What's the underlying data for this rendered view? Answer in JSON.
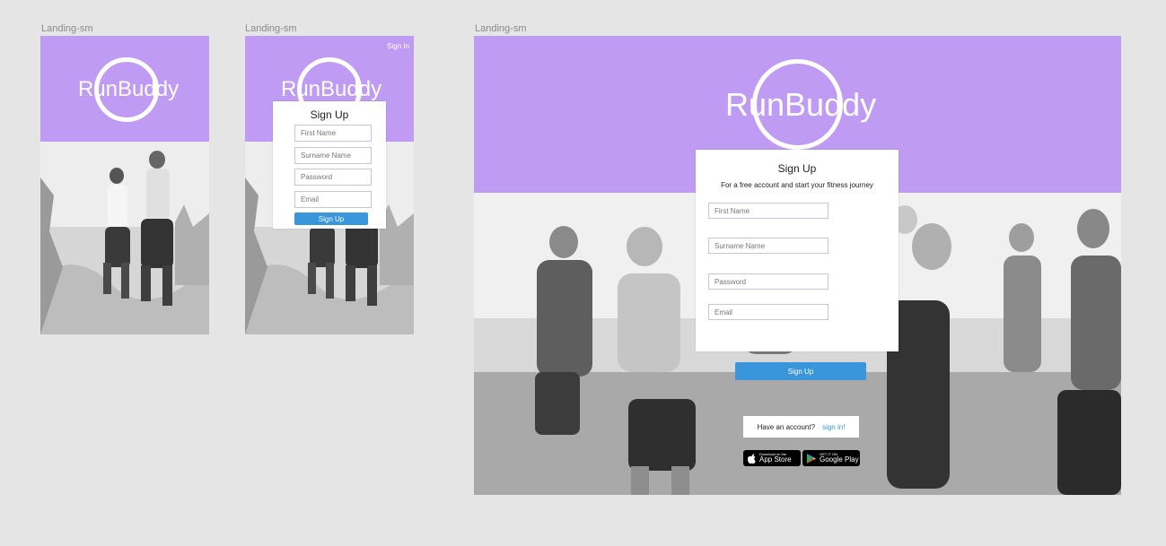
{
  "brand": "RunBuddy",
  "colors": {
    "header": "#bf9bf3",
    "button": "#3a96da",
    "canvas": "#e5e5e5",
    "link": "#3a96da"
  },
  "frames": [
    {
      "label": "Landing-sm"
    },
    {
      "label": "Landing-sm",
      "signin_link": "Sign In",
      "signup": {
        "title": "Sign Up",
        "fields": [
          "First Name",
          "Surname Name",
          "Password",
          "Email"
        ],
        "button": "Sign Up"
      }
    },
    {
      "label": "Landing-sm",
      "signup": {
        "title": "Sign Up",
        "subtitle": "For a free account and start your fitness journey",
        "fields": [
          "First Name",
          "Surname Name",
          "Password",
          "Email"
        ],
        "button": "Sign Up"
      },
      "have_account": "Have an account?",
      "signin_link": "sign in!",
      "app_store": {
        "small": "Download on the",
        "big": "App Store",
        "icon": "apple-icon"
      },
      "google_play": {
        "small": "GET IT ON",
        "big": "Google Play",
        "icon": "play-icon"
      }
    }
  ]
}
